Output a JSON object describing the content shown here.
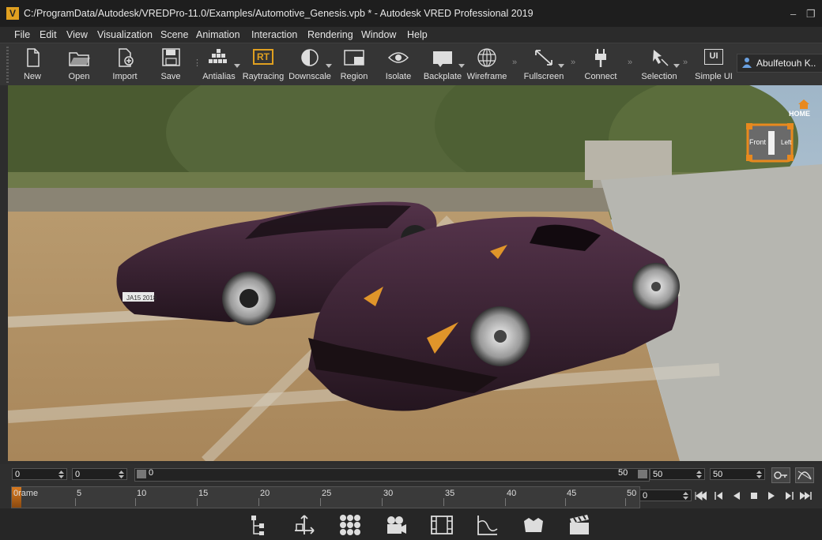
{
  "window": {
    "title": "C:/ProgramData/Autodesk/VREDPro-11.0/Examples/Automotive_Genesis.vpb * - Autodesk VRED Professional 2019",
    "app_icon_letter": "V",
    "minimize_glyph": "–",
    "restore_glyph": "❐"
  },
  "menu": [
    "File",
    "Edit",
    "View",
    "Visualization",
    "Scene",
    "Animation",
    "Interaction",
    "Rendering",
    "Window",
    "Help"
  ],
  "toolbar": {
    "new": "New",
    "open": "Open",
    "import": "Import",
    "save": "Save",
    "antialias": "Antialias",
    "raytracing": "Raytracing",
    "raytracing_badge": "RT",
    "downscale": "Downscale",
    "region": "Region",
    "isolate": "Isolate",
    "backplate": "Backplate",
    "wireframe": "Wireframe",
    "fullscreen": "Fullscreen",
    "connect": "Connect",
    "selection": "Selection",
    "simple_ui": "Simple UI",
    "simple_ui_badge": "UI"
  },
  "user": {
    "name": "Abulfetouh K.."
  },
  "viewcube": {
    "home_label": "HOME",
    "front_label": "Front",
    "left_label": "Left"
  },
  "scene": {
    "license_plate": "JA15 2018"
  },
  "timeline": {
    "spin1": "0",
    "spin2": "0",
    "slider_start": "0",
    "slider_end": "50",
    "spin3": "50",
    "spin4": "50",
    "ruler_labels": [
      "0rame",
      "5",
      "10",
      "15",
      "20",
      "25",
      "30",
      "35",
      "40",
      "45",
      "50"
    ],
    "current_frame": "0"
  },
  "colors": {
    "accent": "#e0a020",
    "toolbar_bg": "#353535",
    "car_paint": "#3b2232"
  },
  "icons": {
    "bottom": [
      "scenegraph-icon",
      "transform-icon",
      "materials-icon",
      "camera-icon",
      "clips-icon",
      "curve-editor-icon",
      "variants-icon",
      "render-settings-icon"
    ]
  }
}
